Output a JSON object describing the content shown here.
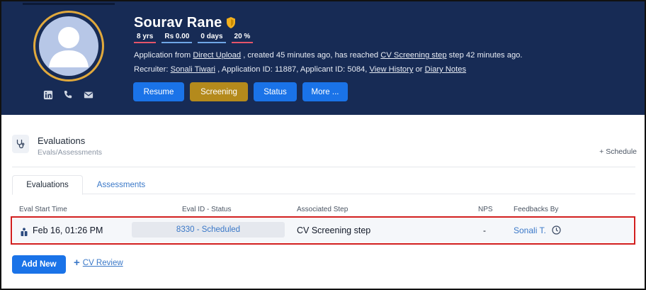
{
  "profile": {
    "name": "Sourav Rane",
    "stats": [
      "8 yrs",
      "Rs 0.00",
      "0 days",
      "20 %"
    ],
    "line1": {
      "prefix": "Application from ",
      "source_link": "Direct Upload",
      "middle": " , created 45 minutes ago, has reached ",
      "step_link": "CV Screening step",
      "suffix": " step 42 minutes ago."
    },
    "line2": {
      "prefix": "Recruiter: ",
      "recruiter_link": "Sonali Tiwari",
      "middle": " , Application ID: 11887, Applicant ID: 5084, ",
      "history_link": "View History",
      "or": " or ",
      "notes_link": "Diary Notes"
    },
    "buttons": {
      "resume": "Resume",
      "screening": "Screening",
      "status": "Status",
      "more": "More ..."
    }
  },
  "evaluations": {
    "title": "Evaluations",
    "subtitle": "Evals/Assessments",
    "schedule": "+ Schedule",
    "tabs": [
      "Evaluations",
      "Assessments"
    ],
    "columns": [
      "Eval Start Time",
      "Eval ID - Status",
      "Associated Step",
      "NPS",
      "Feedbacks By"
    ],
    "row": {
      "start_time": "Feb 16, 01:26 PM",
      "id_status": "8330 - Scheduled",
      "step": "CV Screening step",
      "nps": "-",
      "feedback_by": "Sonali T."
    },
    "add_button": "Add New",
    "cv_review": "CV Review"
  },
  "colors": {
    "header_bg": "#172b55",
    "avatar_ring": "#e1a93c",
    "primary_button": "#1a73e8",
    "screening_button": "#b48a1c",
    "highlight_outline": "#d11f1f",
    "link": "#3a78c8"
  },
  "icons": [
    "linkedin-icon",
    "phone-icon",
    "mail-icon",
    "shield-icon",
    "stethoscope-icon",
    "briefcase-icon",
    "clock-icon"
  ]
}
